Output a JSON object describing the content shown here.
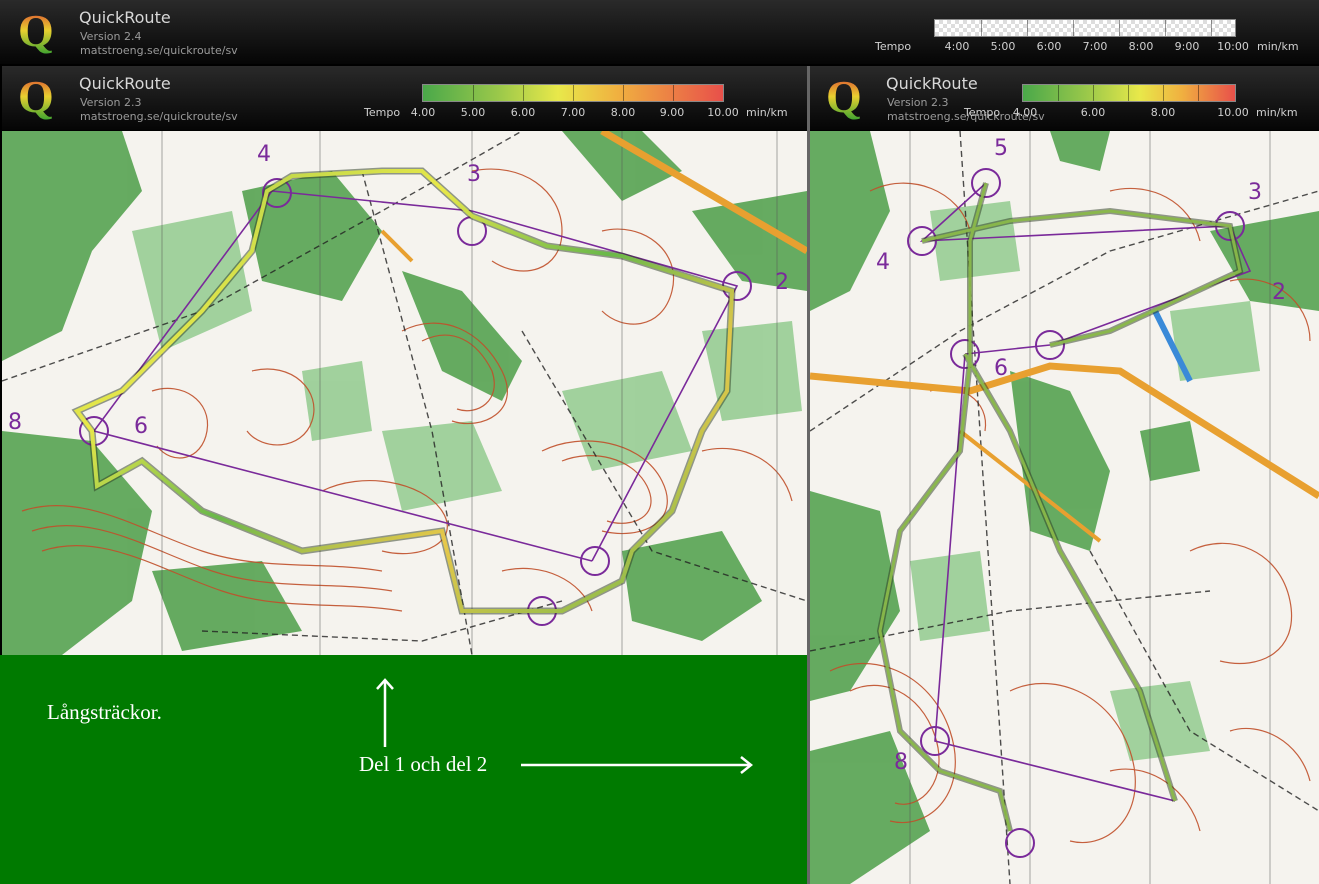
{
  "top_header": {
    "app_name": "QuickRoute",
    "version": "Version 2.4",
    "url": "matstroeng.se/quickroute/sv",
    "tempo_label": "Tempo",
    "unit": "min/km",
    "ticks": [
      "4:00",
      "5:00",
      "6:00",
      "7:00",
      "8:00",
      "9:00",
      "10:00"
    ]
  },
  "left_map_header": {
    "app_name": "QuickRoute",
    "version": "Version 2.3",
    "url": "matstroeng.se/quickroute/sv",
    "tempo_label": "Tempo",
    "unit": "min/km",
    "ticks": [
      "4.00",
      "5.00",
      "6.00",
      "7.00",
      "8.00",
      "9.00",
      "10.00"
    ]
  },
  "right_map_header": {
    "app_name": "QuickRoute",
    "version": "Version 2.3",
    "url": "matstroeng.se/quickroute/sv",
    "tempo_label": "Tempo",
    "unit": "min/km",
    "ticks": [
      "4.00",
      "6.00",
      "8.00",
      "10.00"
    ]
  },
  "left_map": {
    "control_numbers": [
      "4",
      "3",
      "2",
      "6",
      "8"
    ]
  },
  "right_map": {
    "control_numbers": [
      "5",
      "3",
      "4",
      "2",
      "6",
      "8"
    ]
  },
  "captions": {
    "title": "Långsträckor.",
    "parts": "Del 1 och del 2"
  },
  "colors": {
    "panel_green": "#007a00",
    "route_slow": "#e8504a",
    "route_mid": "#e8e84a",
    "route_fast": "#4aa84a",
    "control_purple": "#7a2a9a",
    "map_contour_brown": "#c0502a",
    "map_green": "#3c9a3c",
    "road_orange": "#e8a030"
  }
}
